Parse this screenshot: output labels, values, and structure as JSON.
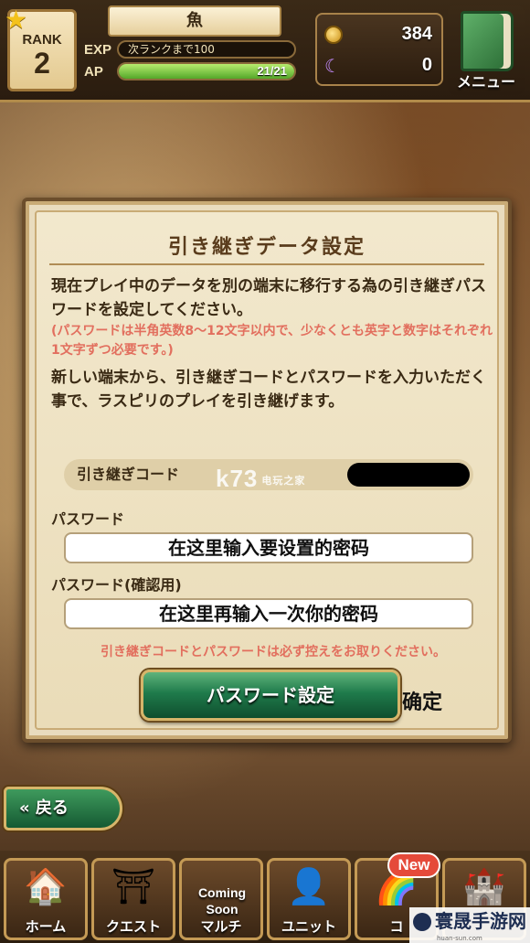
{
  "header": {
    "rank_label": "RANK",
    "rank_value": "2",
    "player_name": "魚",
    "exp_label": "EXP",
    "exp_text": "次ランクまで100",
    "ap_label": "AP",
    "ap_text": "21/21",
    "ap_fraction": 1.0,
    "gold": "384",
    "gems": "0",
    "menu_label": "メニュー"
  },
  "dialog": {
    "title": "引き継ぎデータ設定",
    "paragraph1": "現在プレイ中のデータを別の端末に移行する為の引き継ぎパスワードを設定してください。",
    "note": "(パスワードは半角英数8～12文字以内で、少なくとも英字と数字はそれぞれ1文字ずつ必要です。)",
    "paragraph2": "新しい端末から、引き継ぎコードとパスワードを入力いただく事で、ラスピリのプレイを引き継げます。",
    "code_label": "引き継ぎコード",
    "password_label": "パスワード",
    "password_value": "在这里输入要设置的密码",
    "password_confirm_label": "パスワード(確認用)",
    "password_confirm_value": "在这里再输入一次你的密码",
    "warning": "引き継ぎコードとパスワードは必ず控えをお取りください。",
    "set_button": "パスワード設定",
    "confirm_annotation": "确定"
  },
  "watermark": {
    "main": "k73",
    "sub": "电玩之家"
  },
  "back_button": "戻る",
  "bottom_nav": [
    {
      "label": "ホーム",
      "icon": "house-icon"
    },
    {
      "label": "クエスト",
      "icon": "gate-icon"
    },
    {
      "label": "マルチ",
      "icon": "coming-soon-icon",
      "overlay": "Coming Soon"
    },
    {
      "label": "ユニット",
      "icon": "character-icon"
    },
    {
      "label": "コ",
      "icon": "rainbow-icon"
    },
    {
      "label": "",
      "icon": "towers-icon"
    }
  ],
  "new_badge": "New",
  "site_mark": {
    "name": "寰晟手游网",
    "url": "huan-sun.com"
  },
  "colors": {
    "accent_green": "#1f7b4b",
    "note_red": "#e26f5e",
    "frame_gold": "#d6b56a"
  }
}
